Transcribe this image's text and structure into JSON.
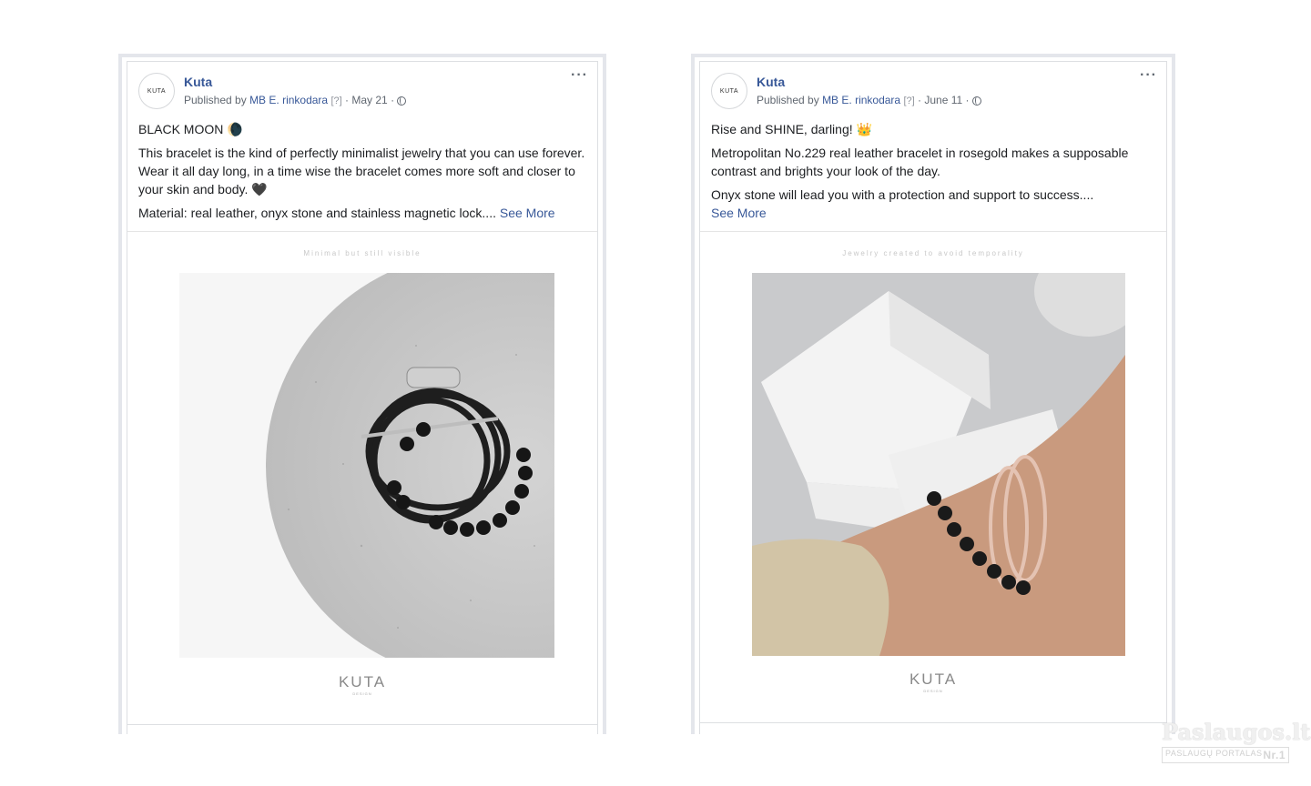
{
  "posts": [
    {
      "page_name": "Kuta",
      "avatar_text": "KUTA",
      "published_by_prefix": "Published by",
      "publisher": "MB E. rinkodara",
      "help_mark": "[?]",
      "date": "May 21",
      "separator": "·",
      "more_icon": "···",
      "text_line1": "BLACK MOON 🌘",
      "text_para2": "This bracelet is the kind of perfectly minimalist jewelry that you can use forever. Wear it all day long, in a time wise the bracelet comes more soft and closer to your skin and body. 🖤",
      "text_para3": "Material: real leather, onyx stone and stainless magnetic lock....",
      "see_more": "See More",
      "image_caption": "Minimal but still visible",
      "brand": "KUTA",
      "brand_sub": "DESIGN"
    },
    {
      "page_name": "Kuta",
      "avatar_text": "KUTA",
      "published_by_prefix": "Published by",
      "publisher": "MB E. rinkodara",
      "help_mark": "[?]",
      "date": "June 11",
      "separator": "·",
      "more_icon": "···",
      "text_line1": "Rise and SHINE, darling! 👑",
      "text_para2": "Metropolitan No.229 real leather bracelet in rosegold makes a supposable contrast and brights your look of the day.",
      "text_para3": "Onyx stone will lead you with a protection and support to success....",
      "see_more": "See More",
      "image_caption": "Jewelry created to avoid temporality",
      "brand": "KUTA",
      "brand_sub": "DESIGN"
    }
  ],
  "watermark": {
    "main": "Paslaugos.lt",
    "sub": "PASLAUGŲ PORTALAS",
    "badge": "Nr.1"
  },
  "colors": {
    "link": "#385898",
    "meta": "#606770",
    "border": "#dddfe2"
  }
}
